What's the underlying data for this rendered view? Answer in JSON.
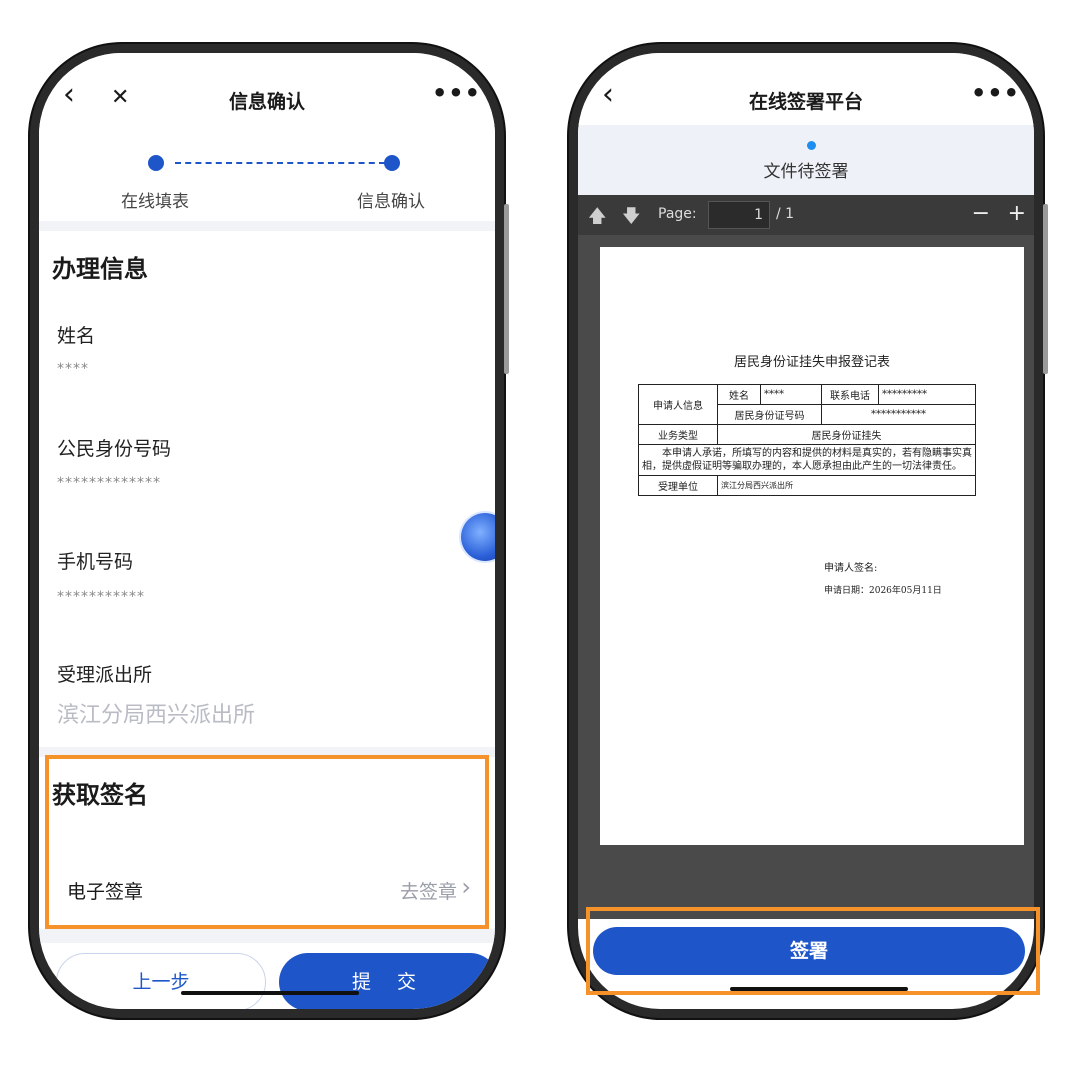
{
  "left": {
    "nav_title": "信息确认",
    "back_icon": "‹",
    "close_icon": "✕",
    "more_icon": "•••",
    "steps": [
      "在线填表",
      "信息确认"
    ],
    "section1_title": "办理信息",
    "fields": [
      {
        "label": "姓名",
        "value": "****"
      },
      {
        "label": "公民身份号码",
        "value": "*************"
      },
      {
        "label": "手机号码",
        "value": "***********"
      },
      {
        "label": "受理派出所",
        "value": "滨江分局西兴派出所"
      }
    ],
    "section2_title": "获取签名",
    "signature_label": "电子签章",
    "signature_action": "去签章",
    "chevron_icon": "›",
    "prev_button": "上一步",
    "submit_button": "提 交"
  },
  "right": {
    "nav_title": "在线签署平台",
    "back_icon": "‹",
    "more_icon": "•••",
    "status_text": "文件待签署",
    "pdf": {
      "page_label": "Page:",
      "page_current": "1",
      "page_total": "/ 1",
      "zoom_out": "−",
      "zoom_in": "+",
      "up_arrow": "🡅",
      "down_arrow": "🡇"
    },
    "doc": {
      "title": "居民身份证挂失申报登记表",
      "applicant_info": "申请人信息",
      "name_label": "姓名",
      "name_value": "****",
      "phone_label": "联系电话",
      "phone_value": "*********",
      "id_label": "居民身份证号码",
      "id_value": "***********",
      "business_label": "业务类型",
      "business_value": "居民身份证挂失",
      "declaration": "本申请人承诺，所填写的内容和提供的材料是真实的，若有隐瞒事实真相，提供虚假证明等骗取办理的，本人愿承担由此产生的一切法律责任。",
      "office_label": "受理单位",
      "office_value": "滨江分局西兴派出所",
      "sign_label": "申请人签名:",
      "date_label": "申请日期：2026年05月11日"
    },
    "sign_button": "签署"
  },
  "colors": {
    "primary": "#1e56c9",
    "highlight": "#f5922a",
    "pdf_bg": "#4a4a4a"
  }
}
